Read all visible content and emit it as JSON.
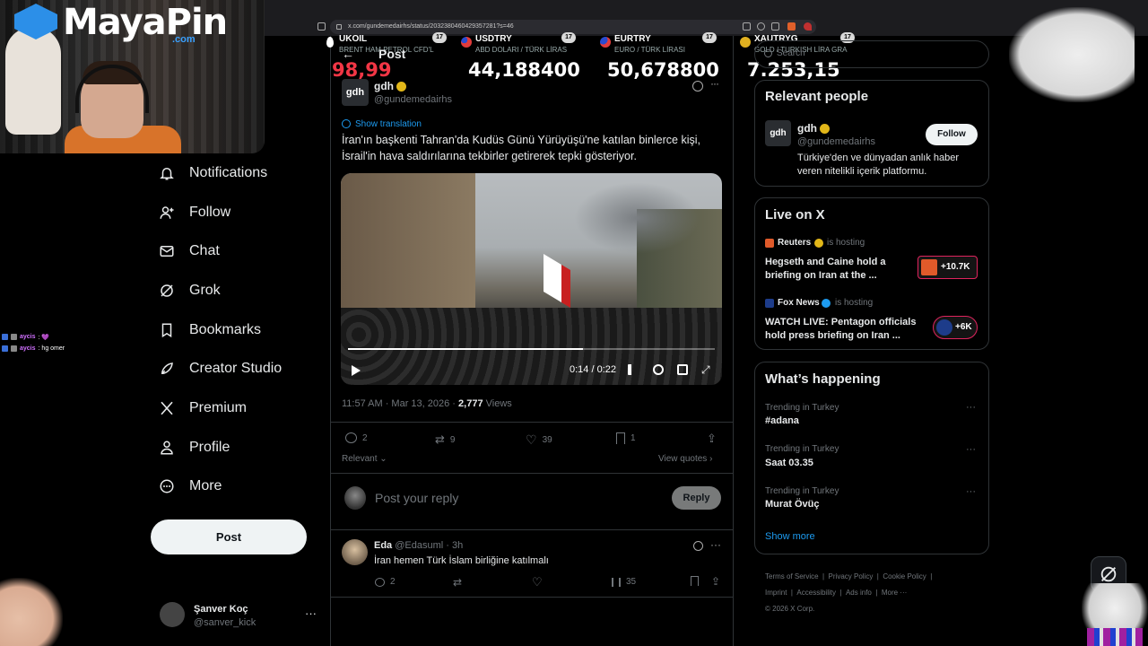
{
  "browser": {
    "url": "x.com/gundemedairhs/status/2032380460429357281?s=46"
  },
  "ticker": [
    {
      "symbol": "UKOIL",
      "subtitle": "BRENT HAM PETROL CFD'L",
      "price": "98,99",
      "price_color": "#f23645",
      "flag_color": "#ffffff"
    },
    {
      "symbol": "USDTRY",
      "subtitle": "ABD DOLARI / TÜRK LİRAS",
      "price": "44,188400",
      "price_color": "#ffffff",
      "flag_color": "#e23b3b"
    },
    {
      "symbol": "EURTRY",
      "subtitle": "EURO / TÜRK LİRASI",
      "price": "50,678800",
      "price_color": "#ffffff",
      "flag_color": "#2a4bd0"
    },
    {
      "symbol": "XAUTRYG",
      "subtitle": "GOLD / TURKISH LİRA GRA",
      "price": "7.253,15",
      "price_color": "#ffffff",
      "flag_color": "#e0b020"
    }
  ],
  "overlay": {
    "brand": "MayaPin",
    "brand_suffix": ".com"
  },
  "chat": [
    {
      "user": "aycis",
      "message": ": 💜"
    },
    {
      "user": "aycis",
      "message": ": hg omer"
    }
  ],
  "nav": {
    "items": [
      {
        "label": "Notifications",
        "icon": "bell-icon"
      },
      {
        "label": "Follow",
        "icon": "follow-icon"
      },
      {
        "label": "Chat",
        "icon": "mail-icon"
      },
      {
        "label": "Grok",
        "icon": "grok-icon"
      },
      {
        "label": "Bookmarks",
        "icon": "bookmark-icon"
      },
      {
        "label": "Creator Studio",
        "icon": "rocket-icon"
      },
      {
        "label": "Premium",
        "icon": "x-logo-icon"
      },
      {
        "label": "Profile",
        "icon": "person-icon"
      },
      {
        "label": "More",
        "icon": "more-circle-icon"
      }
    ],
    "post_label": "Post",
    "account_name": "Şanver Koç",
    "account_handle": "@sanver_kick"
  },
  "header": {
    "title": "Post"
  },
  "tweet": {
    "avatar_text": "gdh",
    "name": "gdh",
    "handle": "@gundemedairhs",
    "show_translation": "Show translation",
    "text_line1": "İran'ın başkenti Tahran'da Kudüs Günü Yürüyüşü'ne katılan binlerce kişi,",
    "text_line2": "İsrail'in hava saldırılarına tekbirler getirerek tepki gösteriyor.",
    "video_time": "0:14 / 0:22",
    "video_progress": 0.64,
    "timestamp": "11:57 AM · Mar 13, 2026 · ",
    "views_count": "2,777",
    "views_label": "Views",
    "replies": "2",
    "reposts": "9",
    "likes": "39",
    "bookmarks": "1",
    "sort_label": "Relevant",
    "view_quotes": "View quotes"
  },
  "reply_box": {
    "placeholder": "Post your reply",
    "button": "Reply"
  },
  "reply": {
    "name": "Eda",
    "handle": "@Edasuml",
    "time": "· 3h",
    "text": "İran hemen Türk İslam birliğine katılmalı",
    "replies": "2",
    "views": "35"
  },
  "search": {
    "placeholder": "Search"
  },
  "relevant_people": {
    "title": "Relevant people",
    "avatar_text": "gdh",
    "name": "gdh",
    "handle": "@gundemedairhs",
    "follow_label": "Follow",
    "bio_line1": "Türkiye'den ve dünyadan anlık haber",
    "bio_line2": "veren nitelikli içerik platformu."
  },
  "live": {
    "title": "Live on X",
    "items": [
      {
        "host": "Reuters",
        "suffix": "is hosting",
        "title_line1": "Hegseth and Caine hold a",
        "title_line2": "briefing on Iran at the ...",
        "count": "+10.7K"
      },
      {
        "host": "Fox News",
        "suffix": "is hosting",
        "title_line1": "WATCH LIVE: Pentagon officials",
        "title_line2": "hold press briefing on Iran ...",
        "count": "+6K"
      }
    ]
  },
  "trends": {
    "title": "What’s happening",
    "items": [
      {
        "context": "Trending in Turkey",
        "name": "#adana"
      },
      {
        "context": "Trending in Turkey",
        "name": "Saat 03.35"
      },
      {
        "context": "Trending in Turkey",
        "name": "Murat Övüç"
      }
    ],
    "show_more": "Show more"
  },
  "footer": {
    "links": [
      "Terms of Service",
      "Privacy Policy",
      "Cookie Policy",
      "Imprint",
      "Accessibility",
      "Ads info",
      "More ···"
    ],
    "copyright": "© 2026 X Corp."
  }
}
